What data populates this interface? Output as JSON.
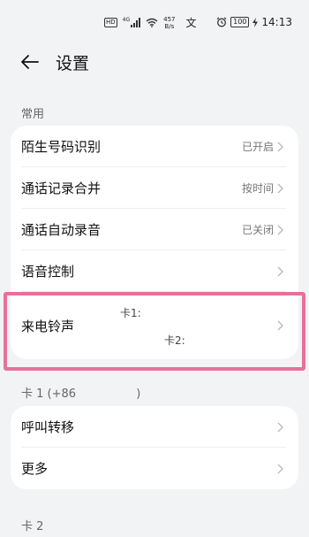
{
  "status_bar": {
    "hd": "HD",
    "signal": "4G",
    "speed_value": "457",
    "speed_unit": "B/s",
    "notif": "文",
    "battery": "100",
    "time": "14:13"
  },
  "header": {
    "title": "设置"
  },
  "sections": {
    "common": "常用",
    "sim1": "卡 1 (+86",
    "sim1_close": ")",
    "sim2": "卡 2"
  },
  "common_items": [
    {
      "label": "陌生号码识别",
      "value": "已开启"
    },
    {
      "label": "通话记录合并",
      "value": "按时间"
    },
    {
      "label": "通话自动录音",
      "value": "已关闭"
    },
    {
      "label": "语音控制",
      "value": ""
    }
  ],
  "ringtone": {
    "label": "来电铃声",
    "sim1": "卡1:",
    "sim2": "卡2:"
  },
  "sim1_items": [
    {
      "label": "呼叫转移"
    },
    {
      "label": "更多"
    }
  ],
  "colors": {
    "highlight": "#e8709a",
    "background": "#f1f3f5",
    "card": "#ffffff"
  }
}
